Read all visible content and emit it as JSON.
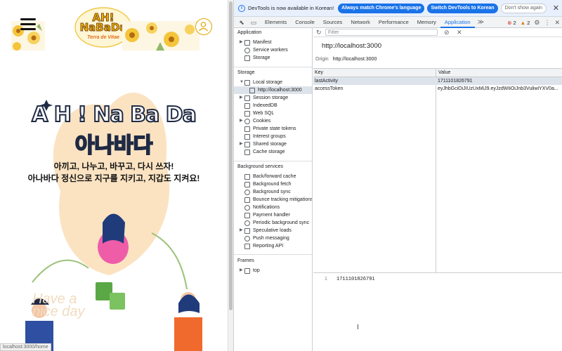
{
  "app": {
    "logo_title": "AH!\nNaBaDa",
    "logo_sub": "Terra de Vitae",
    "hero_title_en": "A H ! Na Ba Da",
    "hero_title_ko": "아나바다",
    "hero_line1": "아끼고, 나누고, 바꾸고, 다시 쓰자!",
    "hero_line2": "아나바다 정신으로 지구를 지키고, 지갑도 지켜요!",
    "watermark": "Have a\nnice day",
    "status_url": "localhost:3000/home"
  },
  "infobar": {
    "message": "DevTools is now available in Korean!",
    "match_language_label": "Always match Chrome's language",
    "switch_label": "Switch DevTools to Korean",
    "dismiss_label": "Don't show again",
    "close_glyph": "✕"
  },
  "tabs": [
    {
      "label": "Elements"
    },
    {
      "label": "Console"
    },
    {
      "label": "Sources"
    },
    {
      "label": "Network"
    },
    {
      "label": "Performance"
    },
    {
      "label": "Memory"
    },
    {
      "label": "Application"
    }
  ],
  "toolbar_status": {
    "errors": "2",
    "warnings": "2",
    "more_glyph": "≫"
  },
  "sidebar": {
    "application_title": "Application",
    "application_items": [
      {
        "label": "Manifest"
      },
      {
        "label": "Service workers"
      },
      {
        "label": "Storage"
      }
    ],
    "storage_title": "Storage",
    "storage_items": [
      {
        "label": "Local storage"
      },
      {
        "label": "http://localhost:3000"
      },
      {
        "label": "Session storage"
      },
      {
        "label": "IndexedDB"
      },
      {
        "label": "Web SQL"
      },
      {
        "label": "Cookies"
      },
      {
        "label": "Private state tokens"
      },
      {
        "label": "Interest groups"
      },
      {
        "label": "Shared storage"
      },
      {
        "label": "Cache storage"
      }
    ],
    "background_title": "Background services",
    "background_items": [
      {
        "label": "Back/forward cache"
      },
      {
        "label": "Background fetch"
      },
      {
        "label": "Background sync"
      },
      {
        "label": "Bounce tracking mitigations"
      },
      {
        "label": "Notifications"
      },
      {
        "label": "Payment handler"
      },
      {
        "label": "Periodic background sync"
      },
      {
        "label": "Speculative loads"
      },
      {
        "label": "Push messaging"
      },
      {
        "label": "Reporting API"
      }
    ],
    "frames_title": "Frames",
    "frames_items": [
      {
        "label": "top"
      }
    ]
  },
  "main": {
    "filter_placeholder": "Filter",
    "origin_title": "http://localhost:3000",
    "origin_key": "Origin",
    "origin_value": "http://localhost:3000",
    "columns": {
      "key": "Key",
      "value": "Value"
    },
    "rows": [
      {
        "key": "lastActivity",
        "value": "1711101826791"
      },
      {
        "key": "accessToken",
        "value": "eyJhbGciOiJIUzUxMiJ9.eyJzdWIiOiJnb3VuliwiYXV0a..."
      }
    ],
    "preview_line": "1",
    "preview_value": "1711101826791"
  }
}
